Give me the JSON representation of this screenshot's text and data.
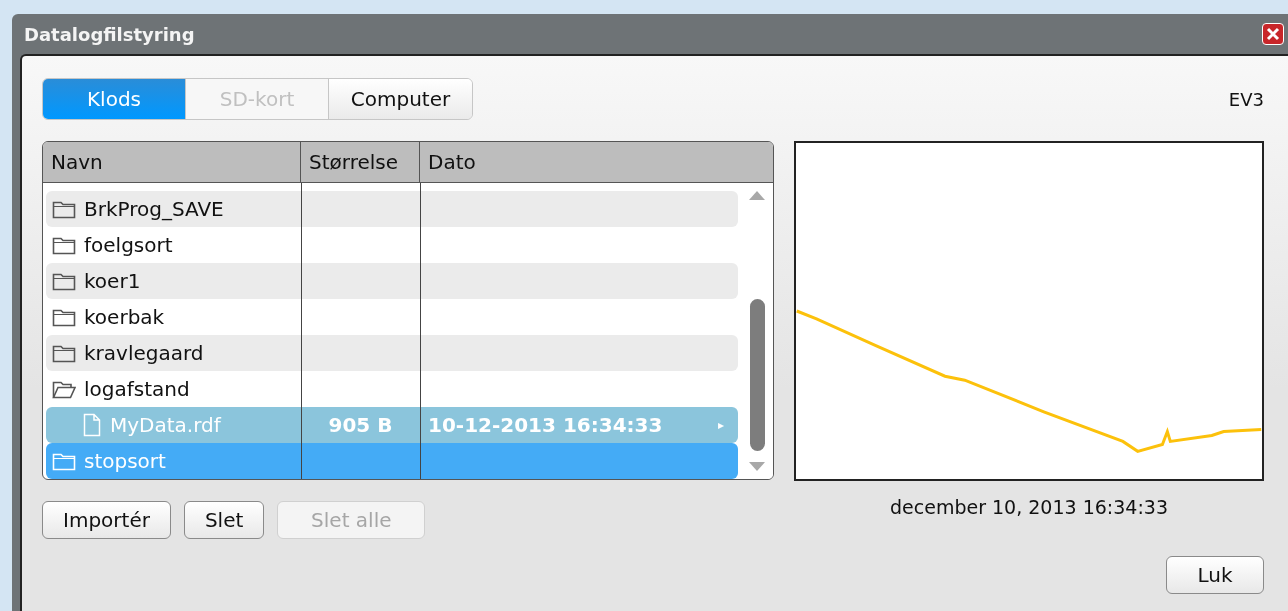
{
  "window": {
    "title": "Datalogfilstyring"
  },
  "tabs": [
    {
      "label": "Klods",
      "selected": true,
      "disabled": false
    },
    {
      "label": "SD-kort",
      "selected": false,
      "disabled": true
    },
    {
      "label": "Computer",
      "selected": false,
      "disabled": false
    }
  ],
  "device": "EV3",
  "table": {
    "columns": [
      "Navn",
      "Størrelse",
      "Dato"
    ],
    "rows": [
      {
        "kind": "folder",
        "name": "BrkProg_SAVE",
        "selected": false,
        "focused": false
      },
      {
        "kind": "folder",
        "name": "foelgsort",
        "selected": false,
        "focused": false
      },
      {
        "kind": "folder",
        "name": "koer1",
        "selected": false,
        "focused": false
      },
      {
        "kind": "folder",
        "name": "koerbak",
        "selected": false,
        "focused": false
      },
      {
        "kind": "folder",
        "name": "kravlegaard",
        "selected": false,
        "focused": false
      },
      {
        "kind": "folder-open",
        "name": "logafstand",
        "selected": false,
        "focused": false,
        "children": [
          {
            "kind": "file",
            "name": "MyData.rdf",
            "size": "905 B",
            "date": "10-12-2013 16:34:33",
            "marker": "▸",
            "selected": true,
            "focused": false
          }
        ]
      },
      {
        "kind": "folder",
        "name": "stopsort",
        "selected": false,
        "focused": true
      }
    ]
  },
  "buttons": [
    {
      "label": "Importér",
      "disabled": false
    },
    {
      "label": "Slet",
      "disabled": false
    },
    {
      "label": "Slet alle",
      "disabled": true
    }
  ],
  "preview": {
    "caption": "december 10, 2013 16:34:33"
  },
  "close_button": "Luk"
}
